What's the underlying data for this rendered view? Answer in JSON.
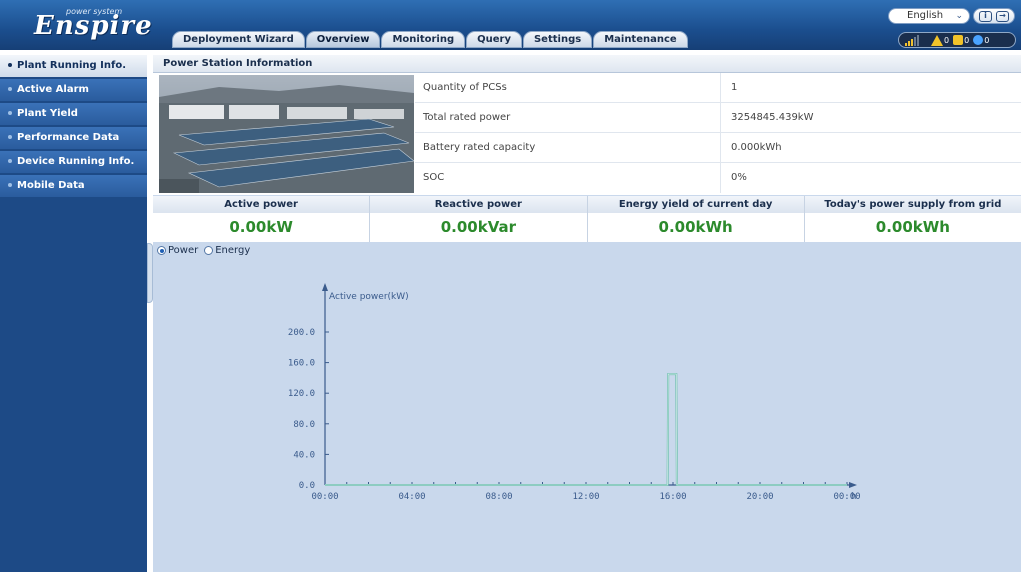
{
  "app": {
    "logo_tagline": "power system",
    "logo_name": "Enspire",
    "language": "English",
    "colors": {
      "header": "#1b4e8e",
      "sidebar": "#1d4a86",
      "accent_green": "#2c8a2c",
      "chart_line": "#6fbfb0",
      "chart_axis": "#3a5b8c"
    }
  },
  "nav": {
    "tabs": [
      {
        "label": "Deployment Wizard",
        "active": false
      },
      {
        "label": "Overview",
        "active": true
      },
      {
        "label": "Monitoring",
        "active": false
      },
      {
        "label": "Query",
        "active": false
      },
      {
        "label": "Settings",
        "active": false
      },
      {
        "label": "Maintenance",
        "active": false
      }
    ]
  },
  "status": {
    "major_alarm_count": "0",
    "minor_alarm_count": "0",
    "warning_count": "0",
    "icons": [
      "signal-strength-icon",
      "major-alarm-icon",
      "minor-alarm-icon",
      "info-alarm-icon",
      "help-icon",
      "logout-icon"
    ]
  },
  "sidebar": {
    "items": [
      {
        "label": "Plant Running Info.",
        "active": true
      },
      {
        "label": "Active Alarm",
        "active": false
      },
      {
        "label": "Plant Yield",
        "active": false
      },
      {
        "label": "Performance Data",
        "active": false
      },
      {
        "label": "Device Running Info.",
        "active": false
      },
      {
        "label": "Mobile Data",
        "active": false
      }
    ]
  },
  "station": {
    "title": "Power Station Information",
    "rows": [
      {
        "label": "Quantity of PCSs",
        "value": "1"
      },
      {
        "label": "Total rated power",
        "value": "3254845.439kW"
      },
      {
        "label": "Battery rated capacity",
        "value": "0.000kWh"
      },
      {
        "label": "SOC",
        "value": "0%"
      }
    ]
  },
  "kpis": [
    {
      "label": "Active power",
      "value": "0.00kW"
    },
    {
      "label": "Reactive power",
      "value": "0.00kVar"
    },
    {
      "label": "Energy yield of current day",
      "value": "0.00kWh"
    },
    {
      "label": "Today's power supply from grid",
      "value": "0.00kWh"
    }
  ],
  "view": {
    "power_label": "Power",
    "energy_label": "Energy",
    "selected": "Power"
  },
  "chart_data": {
    "type": "line",
    "title": "",
    "ylabel": "Active power(kW)",
    "xlabel": "h",
    "ylim": [
      0,
      200
    ],
    "yticks": [
      "0.0",
      "40.0",
      "80.0",
      "120.0",
      "160.0",
      "200.0"
    ],
    "xticks": [
      "00:00",
      "04:00",
      "08:00",
      "12:00",
      "16:00",
      "20:00",
      "00:00"
    ],
    "xlim_hours": [
      0,
      24
    ],
    "grid": false,
    "series": [
      {
        "x_hours": [
          0,
          15.75,
          15.78,
          15.85,
          16.08,
          16.15,
          16.18,
          24
        ],
        "values": [
          0,
          0,
          145,
          145,
          145,
          145,
          0,
          0
        ]
      }
    ]
  }
}
